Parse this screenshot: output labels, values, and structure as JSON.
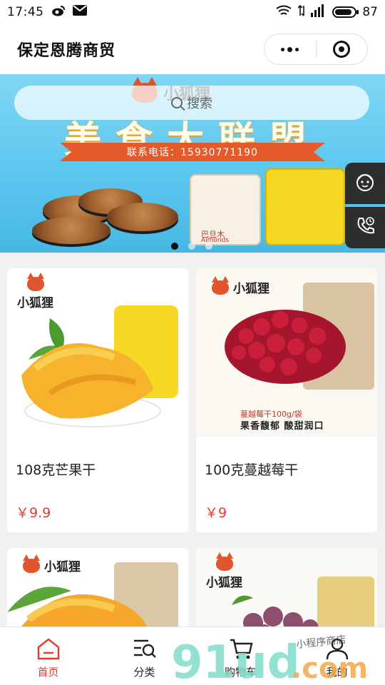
{
  "status_bar": {
    "time": "17:45",
    "battery": "87",
    "battery_level": 0.87
  },
  "header": {
    "title": "保定恩腾商贸"
  },
  "search": {
    "placeholder": "搜索"
  },
  "banner": {
    "brand": "小狐狸",
    "headline": "美食大联盟",
    "contact": "联系电话：15930771190",
    "package_text_1": "巴旦木",
    "package_text_2": "Almonds",
    "slide_count": 3,
    "active_slide": 1
  },
  "products": [
    {
      "brand": "小狐狸",
      "name": "108克芒果干",
      "price": "￥9.9"
    },
    {
      "brand": "小狐狸",
      "name": "100克蔓越莓干",
      "price": "￥9",
      "caption_1": "蔓越莓干100g/袋",
      "caption_2": "果香馥郁 酸甜润口"
    },
    {
      "brand": "小狐狸",
      "name": "",
      "price": ""
    },
    {
      "brand": "小狐狸",
      "name": "",
      "price": ""
    }
  ],
  "tabbar": {
    "items": [
      {
        "label": "首页",
        "icon": "home-icon",
        "active": true
      },
      {
        "label": "分类",
        "icon": "category-search-icon",
        "active": false
      },
      {
        "label": "购物车",
        "icon": "cart-icon",
        "active": false
      },
      {
        "label": "我的",
        "icon": "user-icon",
        "active": false
      }
    ]
  },
  "watermark": {
    "text": "91ud.com",
    "tagline": "小程序商店"
  },
  "colors": {
    "accent": "#e4392f",
    "banner_sky": "#5cc7ef",
    "ribbon": "#e45a2b"
  }
}
